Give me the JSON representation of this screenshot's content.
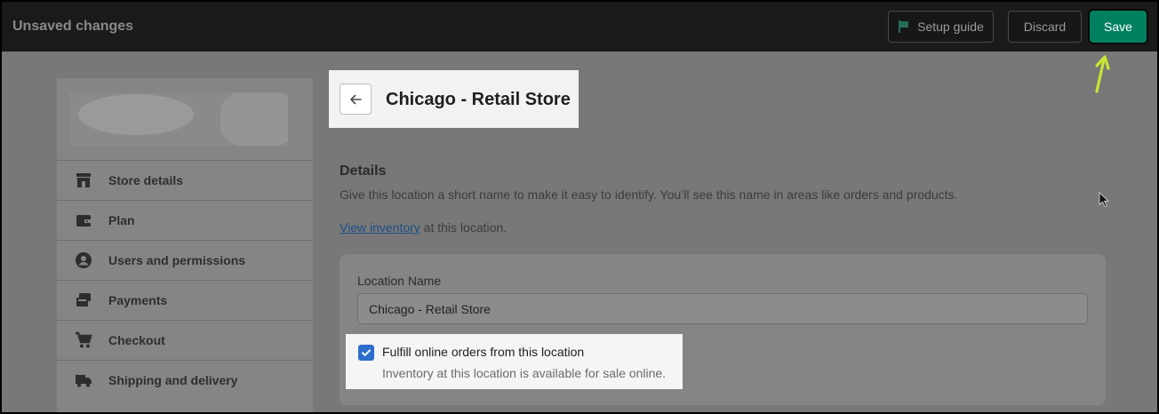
{
  "topbar": {
    "title": "Unsaved changes",
    "setup_guide": "Setup guide",
    "discard": "Discard",
    "save": "Save"
  },
  "sidebar": {
    "items": [
      {
        "label": "Store details",
        "icon": "store-icon"
      },
      {
        "label": "Plan",
        "icon": "wallet-icon"
      },
      {
        "label": "Users and permissions",
        "icon": "user-circle-icon"
      },
      {
        "label": "Payments",
        "icon": "credit-card-icon"
      },
      {
        "label": "Checkout",
        "icon": "cart-icon"
      },
      {
        "label": "Shipping and delivery",
        "icon": "truck-icon"
      }
    ]
  },
  "header": {
    "title": "Chicago - Retail Store"
  },
  "details": {
    "title": "Details",
    "description": "Give this location a short name to make it easy to identify. You’ll see this name in areas like orders and products.",
    "inventory_link": "View inventory",
    "inventory_suffix": " at this location."
  },
  "form": {
    "location_label": "Location Name",
    "location_value": "Chicago - Retail Store",
    "fulfill_label": "Fulfill online orders from this location",
    "fulfill_help": "Inventory at this location is available for sale online.",
    "fulfill_checked": true
  },
  "colors": {
    "save_green": "#00805f",
    "checkbox_blue": "#2c6ecb",
    "annotation_arrow": "#c6e635"
  }
}
